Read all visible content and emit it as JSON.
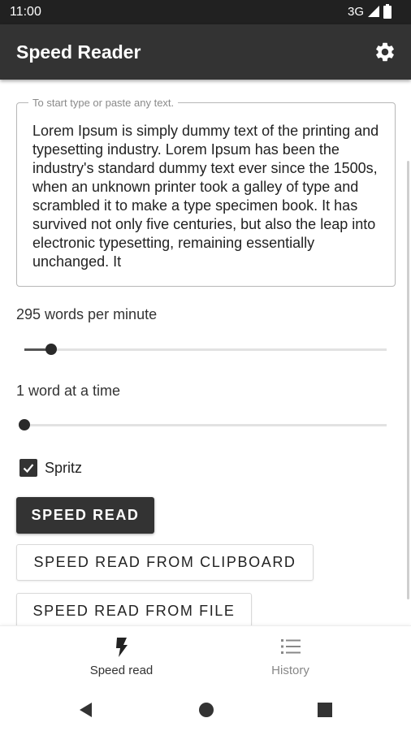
{
  "status_bar": {
    "time": "11:00",
    "network": "3G"
  },
  "app_bar": {
    "title": "Speed Reader",
    "settings_icon": "gear-icon"
  },
  "text_input": {
    "label": "To start type or paste any text.",
    "value": "Lorem Ipsum is simply dummy text of the printing and typesetting industry. Lorem Ipsum has been the industry's standard dummy text ever since the 1500s, when an unknown printer took a galley of type and scrambled it to make a type specimen book. It has survived not only five centuries, but also the leap into electronic typesetting, remaining essentially unchanged. It"
  },
  "speed": {
    "label": "295 words per minute",
    "slider_fraction": 0.075
  },
  "chunk": {
    "label": "1 word at a time",
    "slider_fraction": 0.0
  },
  "spritz": {
    "label": "Spritz",
    "checked": true
  },
  "buttons": {
    "speed_read": "SPEED READ",
    "clipboard": "SPEED READ FROM CLIPBOARD",
    "file": "SPEED READ FROM FILE"
  },
  "bottom_nav": {
    "items": [
      {
        "label": "Speed read",
        "icon": "flash-icon",
        "selected": true
      },
      {
        "label": "History",
        "icon": "list-icon",
        "selected": false
      }
    ]
  },
  "system_nav": {
    "back_icon": "back-triangle-icon",
    "home_icon": "home-circle-icon",
    "recents_icon": "recents-square-icon"
  },
  "colors": {
    "app_bar": "#333333",
    "status_bar": "#212121",
    "primary_button": "#333333",
    "accent": "#333333"
  }
}
